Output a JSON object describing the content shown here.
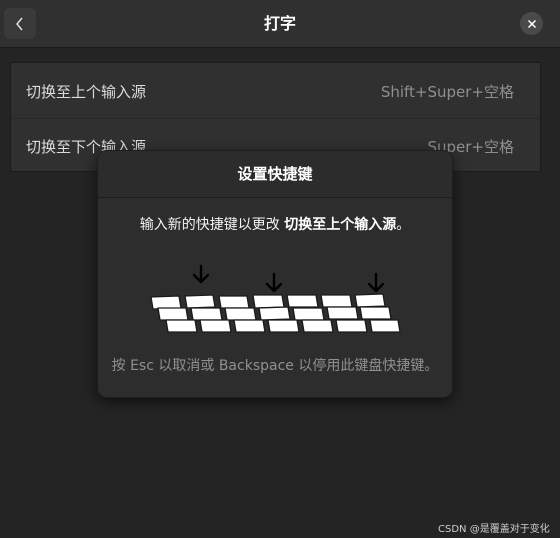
{
  "header": {
    "title": "打字",
    "back_icon": "chevron-left-icon",
    "close_icon": "close-icon"
  },
  "shortcuts": [
    {
      "label": "切换至上个输入源",
      "accel": "Shift+Super+空格"
    },
    {
      "label": "切换至下个输入源",
      "accel": "Super+空格"
    }
  ],
  "dialog": {
    "title": "设置快捷键",
    "instruction_prefix": "输入新的快捷键以更改 ",
    "instruction_target": "切换至上个输入源",
    "instruction_suffix": "。",
    "illustration_icon": "keyboard-keys-icon",
    "hint": "按 Esc 以取消或 Backspace 以停用此键盘快捷键。"
  },
  "watermark": "CSDN @是覆盖对于变化",
  "colors": {
    "background": "#242424",
    "headerbar": "#303030",
    "card": "#303030",
    "dialog_body": "#2d2d2d",
    "secondary_text": "#8f8f8f"
  }
}
